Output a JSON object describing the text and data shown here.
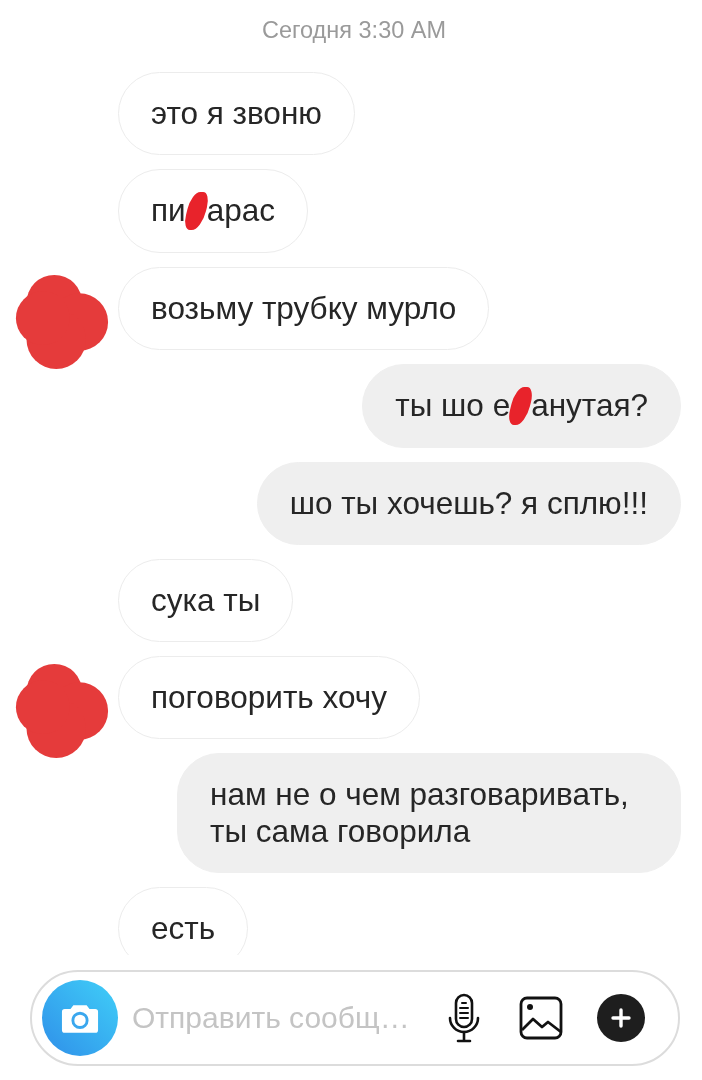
{
  "timestamp": "Сегодня 3:30 AM",
  "messages": [
    {
      "outgoing": false,
      "avatar_covered": false,
      "parts": [
        {
          "kind": "text",
          "text": "это я звоню"
        }
      ]
    },
    {
      "outgoing": false,
      "avatar_covered": false,
      "parts": [
        {
          "kind": "text",
          "text": "пи"
        },
        {
          "kind": "redaction"
        },
        {
          "kind": "text",
          "text": "арас"
        }
      ]
    },
    {
      "outgoing": false,
      "avatar_covered": true,
      "parts": [
        {
          "kind": "text",
          "text": "возьму трубку мурло"
        }
      ]
    },
    {
      "outgoing": true,
      "parts": [
        {
          "kind": "text",
          "text": "ты шо е"
        },
        {
          "kind": "redaction"
        },
        {
          "kind": "text",
          "text": "анутая?"
        }
      ]
    },
    {
      "outgoing": true,
      "parts": [
        {
          "kind": "text",
          "text": "шо ты хочешь? я сплю!!!"
        }
      ]
    },
    {
      "outgoing": false,
      "avatar_covered": false,
      "parts": [
        {
          "kind": "text",
          "text": "сука ты"
        }
      ]
    },
    {
      "outgoing": false,
      "avatar_covered": true,
      "parts": [
        {
          "kind": "text",
          "text": "поговорить хочу"
        }
      ]
    },
    {
      "outgoing": true,
      "parts": [
        {
          "kind": "text",
          "text": "нам не о чем разговаривать, ты сама говорила"
        }
      ]
    },
    {
      "outgoing": false,
      "avatar_covered": false,
      "parts": [
        {
          "kind": "text",
          "text": "есть"
        }
      ]
    }
  ],
  "composer": {
    "placeholder": "Отправить сообщ…"
  }
}
